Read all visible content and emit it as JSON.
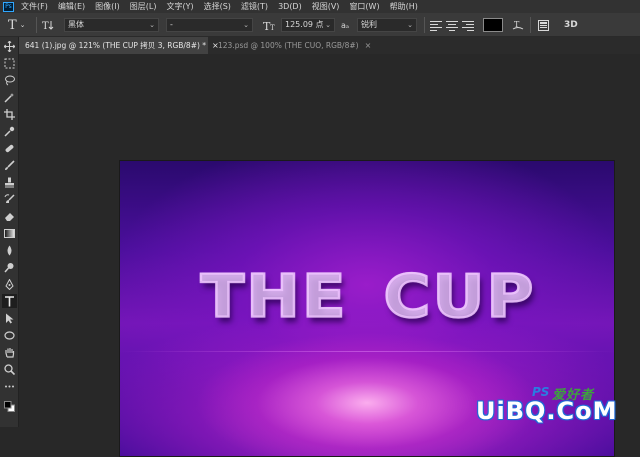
{
  "app": {
    "logo_text": "Ps",
    "menu": [
      "文件(F)",
      "编辑(E)",
      "图像(I)",
      "图层(L)",
      "文字(Y)",
      "选择(S)",
      "滤镜(T)",
      "3D(D)",
      "视图(V)",
      "窗口(W)",
      "帮助(H)"
    ]
  },
  "options": {
    "tool_icon": "T",
    "font_family": "黑体",
    "font_style": "-",
    "font_size": "125.09 点",
    "antialias_label": "aₐ",
    "antialias": "锐利",
    "text_color": "#000000",
    "threed_label": "3D"
  },
  "tabs": [
    {
      "label": "641 (1).jpg @ 121% (THE CUP 拷贝 3, RGB/8#) *",
      "close": "×",
      "active": true
    },
    {
      "label": "123.psd @ 100% (THE CUO, RGB/8#)",
      "close": "×",
      "active": false
    }
  ],
  "canvas": {
    "headline_left": "THE",
    "headline_right": "CUP",
    "colors": {
      "bg_dark": "#2a0a6e",
      "bg_mid": "#7416b8",
      "glow": "#ffb4f0"
    }
  },
  "watermark": {
    "main": "UiBQ.CoM",
    "ps": "PS",
    "cn": "爱好者"
  },
  "toolbar": {
    "tools": [
      "move-icon",
      "marquee-icon",
      "lasso-icon",
      "magic-wand-icon",
      "crop-icon",
      "eyedropper-icon",
      "healing-icon",
      "brush-icon",
      "stamp-icon",
      "history-brush-icon",
      "eraser-icon",
      "gradient-icon",
      "blur-icon",
      "dodge-icon",
      "pen-icon",
      "type-icon",
      "path-select-icon",
      "shape-icon",
      "hand-icon",
      "zoom-icon",
      "more-icon"
    ],
    "selected": "type-icon"
  }
}
